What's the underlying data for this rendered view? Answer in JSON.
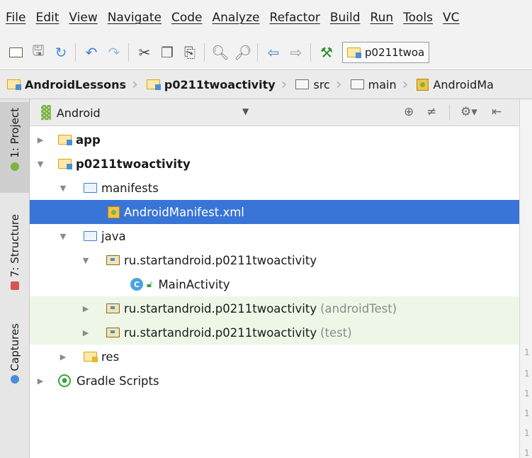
{
  "menu": [
    "File",
    "Edit",
    "View",
    "Navigate",
    "Code",
    "Analyze",
    "Refactor",
    "Build",
    "Run",
    "Tools",
    "VC"
  ],
  "toolbar": {
    "icons": [
      "open-folder",
      "save-all",
      "sync",
      "undo",
      "redo",
      "cut",
      "copy",
      "paste",
      "find",
      "replace",
      "back",
      "forward",
      "make",
      "run-config"
    ],
    "run_config_label": "p0211twoa"
  },
  "breadcrumbs": [
    {
      "label": "AndroidLessons",
      "bold": true
    },
    {
      "label": "p0211twoactivity",
      "bold": true
    },
    {
      "label": "src",
      "bold": false
    },
    {
      "label": "main",
      "bold": false
    },
    {
      "label": "AndroidMa",
      "bold": false
    }
  ],
  "left_stripe": {
    "project_tab": "1: Project",
    "structure_tab": "7: Structure",
    "captures_tab": "Captures"
  },
  "panel": {
    "view_selector": "Android"
  },
  "tree": [
    {
      "label": "app",
      "suffix": "",
      "bold": true,
      "state": "collapsed"
    },
    {
      "label": "p0211twoactivity",
      "suffix": "",
      "bold": true,
      "state": "expanded"
    },
    {
      "label": "manifests",
      "suffix": "",
      "bold": false,
      "state": "expanded"
    },
    {
      "label": "AndroidManifest.xml",
      "suffix": "",
      "bold": false,
      "state": "leaf",
      "selected": true
    },
    {
      "label": "java",
      "suffix": "",
      "bold": false,
      "state": "expanded"
    },
    {
      "label": "ru.startandroid.p0211twoactivity",
      "suffix": "",
      "bold": false,
      "state": "expanded"
    },
    {
      "label": "MainActivity",
      "suffix": "",
      "bold": false,
      "state": "leaf"
    },
    {
      "label": "ru.startandroid.p0211twoactivity",
      "suffix": "(androidTest)",
      "bold": false,
      "state": "collapsed"
    },
    {
      "label": "ru.startandroid.p0211twoactivity",
      "suffix": "(test)",
      "bold": false,
      "state": "collapsed"
    },
    {
      "label": "res",
      "suffix": "",
      "bold": false,
      "state": "collapsed"
    },
    {
      "label": "Gradle Scripts",
      "suffix": "",
      "bold": false,
      "state": "collapsed"
    }
  ],
  "gutter_numbers": [
    "1",
    "1",
    "1",
    "1",
    "1",
    "1"
  ]
}
